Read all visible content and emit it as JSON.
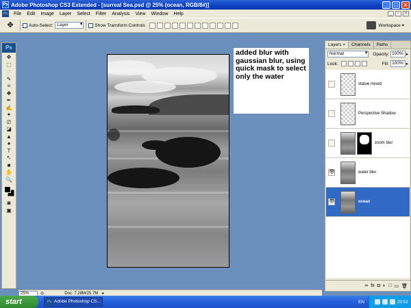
{
  "window": {
    "title": "Adobe Photoshop CS3 Extended - [surreal Sea.psd @ 25% (ocean, RGB/8#)]",
    "minimize": "_",
    "maximize": "□",
    "close": "×"
  },
  "menu": {
    "items": [
      "File",
      "Edit",
      "Image",
      "Layer",
      "Select",
      "Filter",
      "Analysis",
      "View",
      "Window",
      "Help"
    ]
  },
  "options": {
    "auto_select_label": "Auto-Select:",
    "auto_select_value": "Layer",
    "show_transform_label": "Show Transform Controls",
    "workspace_label": "Workspace ▾"
  },
  "tools": {
    "logo": "Ps",
    "glyphs": [
      "✥",
      "⬚",
      "◌",
      "✎",
      "⌗",
      "✚",
      "✒",
      "✍",
      "✦",
      "⎚",
      "◪",
      "▲",
      "●",
      "T",
      "↖",
      "■",
      "✋",
      "🔍"
    ]
  },
  "note": {
    "text": "added blur with gaussian blur, using quick mask to select only the water"
  },
  "status": {
    "zoom": "25%",
    "doc": "Doc: 7.28M/25.7M"
  },
  "layers_panel": {
    "tabs": [
      "Layers ×",
      "Channels",
      "Paths"
    ],
    "blend_mode": "Normal",
    "opacity_label": "Opacity:",
    "opacity_value": "100%",
    "lock_label": "Lock:",
    "fill_label": "Fill:",
    "fill_value": "100%",
    "layers": [
      {
        "name": "statue mixed",
        "visible": false,
        "selected": false,
        "thumb": "transparent"
      },
      {
        "name": "Perspective Shadow",
        "visible": false,
        "selected": false,
        "thumb": "transparent"
      },
      {
        "name": "zoom blur",
        "visible": false,
        "selected": false,
        "thumb": "photo-mask"
      },
      {
        "name": "water blur",
        "visible": true,
        "selected": false,
        "thumb": "photo"
      },
      {
        "name": "ocean",
        "visible": true,
        "selected": true,
        "thumb": "photo"
      }
    ],
    "footer_icons": [
      "∞",
      "fx",
      "◘",
      "◐",
      "□",
      "▭",
      "🗑"
    ]
  },
  "taskbar": {
    "start": "start",
    "task": "Adobe Photoshop CS...",
    "lang": "EN",
    "clock": "20:52"
  }
}
